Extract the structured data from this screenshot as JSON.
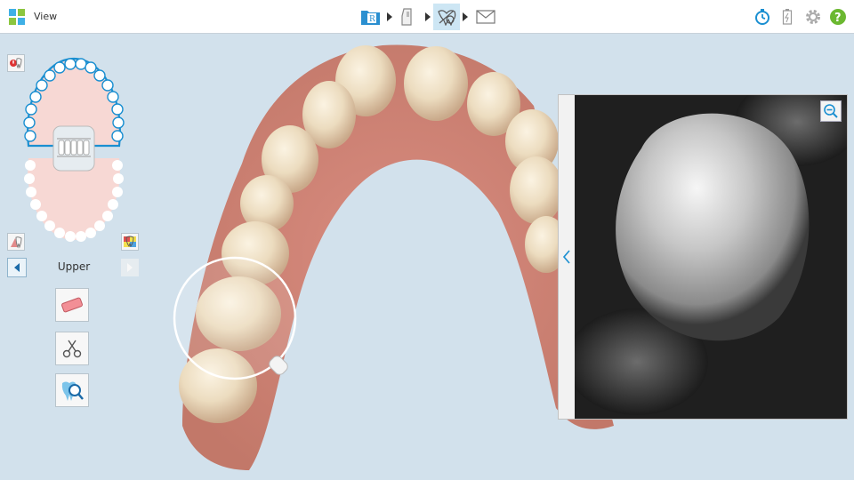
{
  "header": {
    "title": "View",
    "workflow": [
      {
        "name": "rx",
        "icon": "rx-folder-icon"
      },
      {
        "name": "scan",
        "icon": "scan-wand-icon"
      },
      {
        "name": "view",
        "icon": "view-tooth-icon",
        "active": true
      },
      {
        "name": "send",
        "icon": "envelope-icon"
      }
    ],
    "tools": [
      "stopwatch-icon",
      "battery-icon",
      "settings-icon",
      "help-icon"
    ],
    "accent": "#1a8fd1"
  },
  "left_panel": {
    "jaw_label": "Upper",
    "tools": [
      "eraser-tool",
      "trim-tool",
      "tooth-zoom-tool"
    ]
  },
  "niri_panel": {
    "zoom_icon": "zoom-out-icon"
  }
}
